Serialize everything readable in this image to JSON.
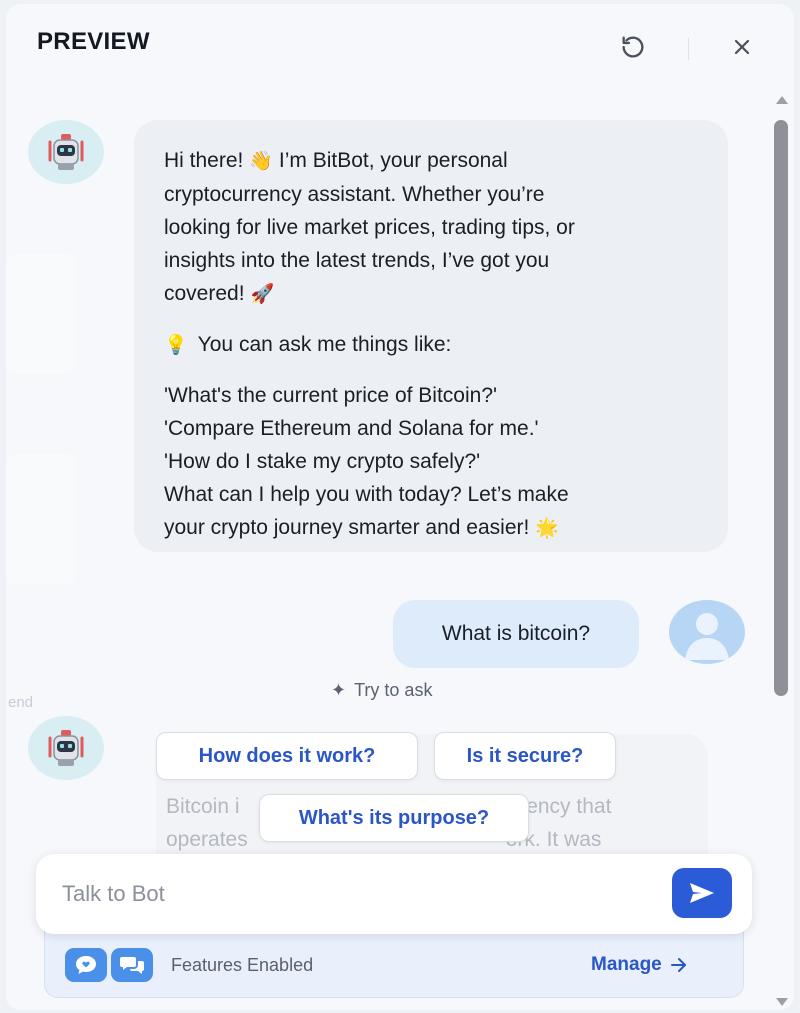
{
  "header": {
    "title": "PREVIEW",
    "refresh_icon": "refresh-icon",
    "close_icon": "close-icon"
  },
  "background_ghost_text": "end",
  "messages": {
    "bot_intro": {
      "line1": "Hi there!",
      "line1_emoji": "👋",
      "line1_rest": "I’m BitBot, your personal",
      "line2": "cryptocurrency assistant. Whether you’re",
      "line3": "looking for live market prices, trading tips, or",
      "line4": "insights into the latest trends, I’ve got you",
      "line5": "covered!",
      "line5_emoji": "🚀",
      "tip_emoji": "💡",
      "tip_text": "You can ask me things like:",
      "ex1": "'What's the current price of Bitcoin?'",
      "ex2": "'Compare Ethereum and Solana for me.'",
      "ex3": "'How do I stake my crypto safely?'",
      "closing1": "What can I help you with today? Let’s make",
      "closing2": "your crypto journey smarter and easier!",
      "closing_emoji": "🌟"
    },
    "user_message": "What is bitcoin?",
    "bot_partial": {
      "row1_left": "Bitcoin i",
      "row1_right": "l currency that",
      "row2_left": "operates",
      "row2_right": "ork. It was"
    }
  },
  "try_to_ask": {
    "label": "Try to ask",
    "chips": [
      "How does it work?",
      "Is it secure?",
      "What's its purpose?"
    ]
  },
  "composer": {
    "placeholder": "Talk to Bot",
    "send_icon": "send-icon"
  },
  "features": {
    "label": "Features Enabled",
    "manage_label": "Manage",
    "icons": [
      "chat-heart-icon",
      "chat-bubbles-icon"
    ]
  },
  "colors": {
    "accent": "#2b5bd7",
    "link": "#2a56c6",
    "bot_bubble": "#eceff4",
    "user_bubble": "#ddebfb"
  }
}
